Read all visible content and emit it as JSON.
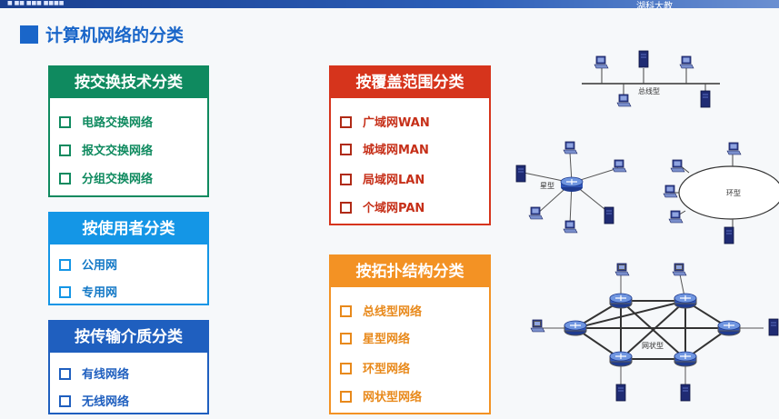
{
  "topbar": {
    "left_text": "■ ■■ ■■■  ■■■■",
    "right_text": "湖科大教"
  },
  "title": "计算机网络的分类",
  "categories": {
    "switching": {
      "title": "按交换技术分类",
      "items": [
        "电路交换网络",
        "报文交换网络",
        "分组交换网络"
      ]
    },
    "users": {
      "title": "按使用者分类",
      "items": [
        "公用网",
        "专用网"
      ]
    },
    "media": {
      "title": "按传输介质分类",
      "items": [
        "有线网络",
        "无线网络"
      ]
    },
    "coverage": {
      "title": "按覆盖范围分类",
      "items": [
        "广域网WAN",
        "城域网MAN",
        "局域网LAN",
        "个域网PAN"
      ]
    },
    "topology": {
      "title": "按拓扑结构分类",
      "items": [
        "总线型网络",
        "星型网络",
        "环型网络",
        "网状型网络"
      ]
    }
  },
  "diagrams": {
    "bus_label": "总线型",
    "star_label": "星型",
    "ring_label": "环型",
    "mesh_label": "网状型"
  },
  "colors": {
    "green": "#0f8a5f",
    "cyan": "#1496e6",
    "blue": "#1f5fbf",
    "red": "#d6341c",
    "orange": "#f39224",
    "title": "#1a66c9"
  }
}
